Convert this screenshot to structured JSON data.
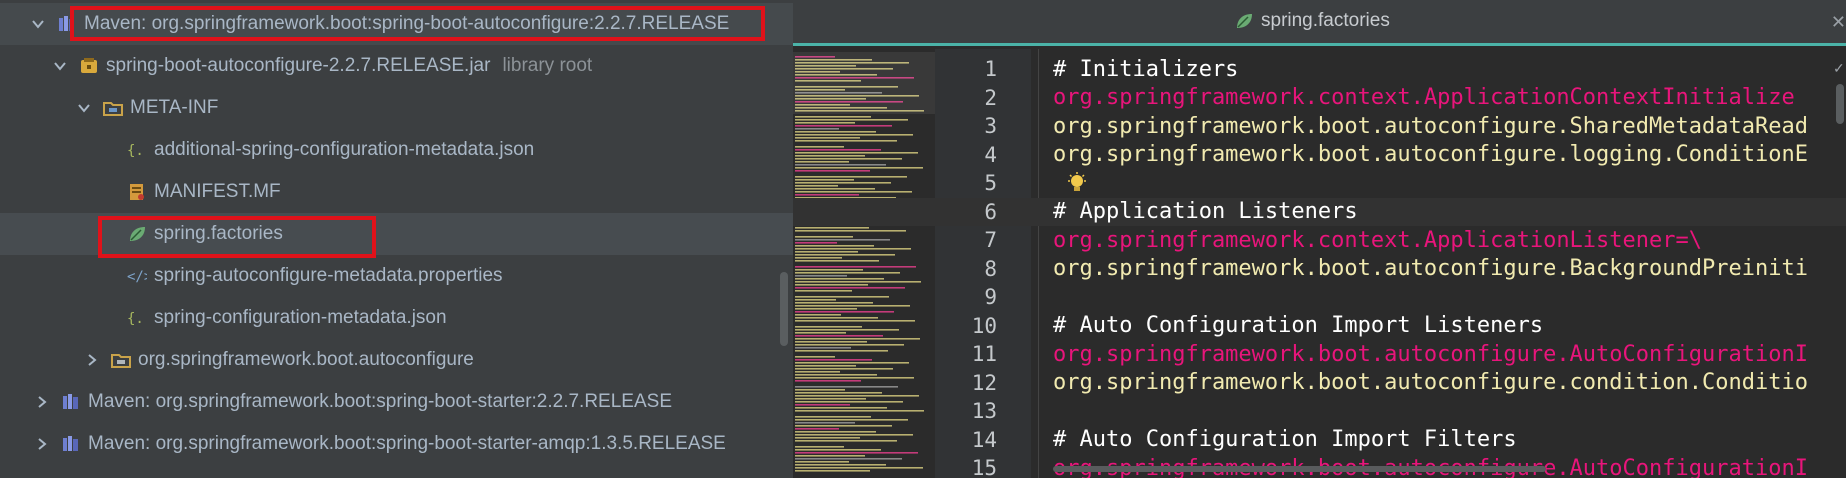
{
  "tree": {
    "rows": [
      {
        "label": "Maven: org.springframework.boot:spring-boot-autoconfigure:2.2.7.RELEASE",
        "suffix": ""
      },
      {
        "label": "spring-boot-autoconfigure-2.2.7.RELEASE.jar",
        "suffix": "library root"
      },
      {
        "label": "META-INF",
        "suffix": ""
      },
      {
        "label": "additional-spring-configuration-metadata.json",
        "suffix": ""
      },
      {
        "label": "MANIFEST.MF",
        "suffix": ""
      },
      {
        "label": "spring.factories",
        "suffix": ""
      },
      {
        "label": "spring-autoconfigure-metadata.properties",
        "suffix": ""
      },
      {
        "label": "spring-configuration-metadata.json",
        "suffix": ""
      },
      {
        "label": "org.springframework.boot.autoconfigure",
        "suffix": ""
      },
      {
        "label": "Maven: org.springframework.boot:spring-boot-starter:2.2.7.RELEASE",
        "suffix": ""
      },
      {
        "label": "Maven: org.springframework.boot:spring-boot-starter-amqp:1.3.5.RELEASE",
        "suffix": ""
      }
    ]
  },
  "editor": {
    "tab_title": "spring.factories",
    "tab_close": "✕",
    "lines": [
      {
        "n": "1",
        "text": "# Initializers",
        "kind": "cmt"
      },
      {
        "n": "2",
        "text": "org.springframework.context.ApplicationContextInitialize",
        "kind": "key"
      },
      {
        "n": "3",
        "text": "org.springframework.boot.autoconfigure.SharedMetadataRead",
        "kind": "val"
      },
      {
        "n": "4",
        "text": "org.springframework.boot.autoconfigure.logging.ConditionE",
        "kind": "val"
      },
      {
        "n": "5",
        "text": "",
        "kind": "blank"
      },
      {
        "n": "6",
        "text": "# Application Listeners",
        "kind": "cmt"
      },
      {
        "n": "7",
        "text": "org.springframework.context.ApplicationListener=\\",
        "kind": "key"
      },
      {
        "n": "8",
        "text": "org.springframework.boot.autoconfigure.BackgroundPreiniti",
        "kind": "val"
      },
      {
        "n": "9",
        "text": "",
        "kind": "blank"
      },
      {
        "n": "10",
        "text": "# Auto Configuration Import Listeners",
        "kind": "cmt"
      },
      {
        "n": "11",
        "text": "org.springframework.boot.autoconfigure.AutoConfigurationI",
        "kind": "key"
      },
      {
        "n": "12",
        "text": "org.springframework.boot.autoconfigure.condition.Conditio",
        "kind": "val"
      },
      {
        "n": "13",
        "text": "",
        "kind": "blank"
      },
      {
        "n": "14",
        "text": "# Auto Configuration Import Filters",
        "kind": "cmt"
      },
      {
        "n": "15",
        "text": "org.springframework.boot.autoconfigure.AutoConfigurationI",
        "kind": "key"
      }
    ],
    "fold_marker": "✓"
  },
  "colors": {
    "highlight_box": "#e0121a",
    "tab_underline": "#4bb3a8",
    "comment": "#ffffff",
    "key": "#e8157b",
    "value": "#f1eab0"
  }
}
